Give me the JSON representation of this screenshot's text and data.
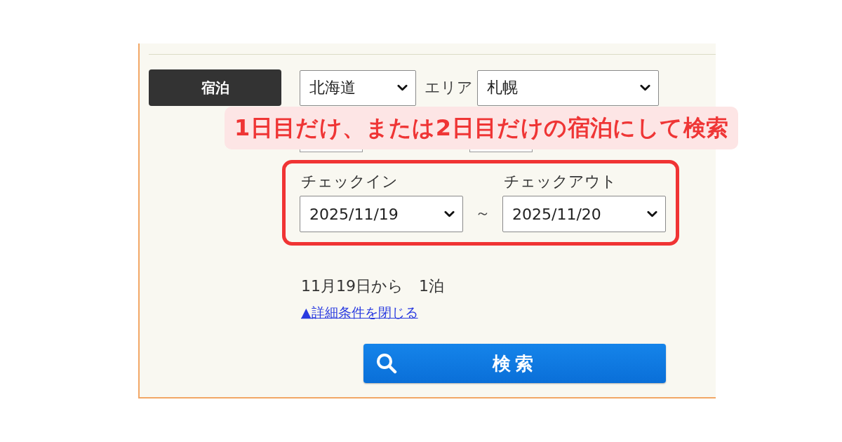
{
  "search_panel": {
    "category_label": "宿泊",
    "prefecture_select": {
      "value": "北海道"
    },
    "area_label": "エリア",
    "area_select": {
      "value": "札幌"
    },
    "callout": "1日目だけ、または2日目だけの宿泊にして検索",
    "date_range": {
      "checkin_label": "チェックイン",
      "checkin_select": {
        "value": "2025/11/19"
      },
      "separator": "～",
      "checkout_label": "チェックアウト",
      "checkout_select": {
        "value": "2025/11/20"
      }
    },
    "stay_summary": "11月19日から　1泊",
    "details_link": "▲詳細条件を閉じる",
    "search_button": "検索"
  }
}
